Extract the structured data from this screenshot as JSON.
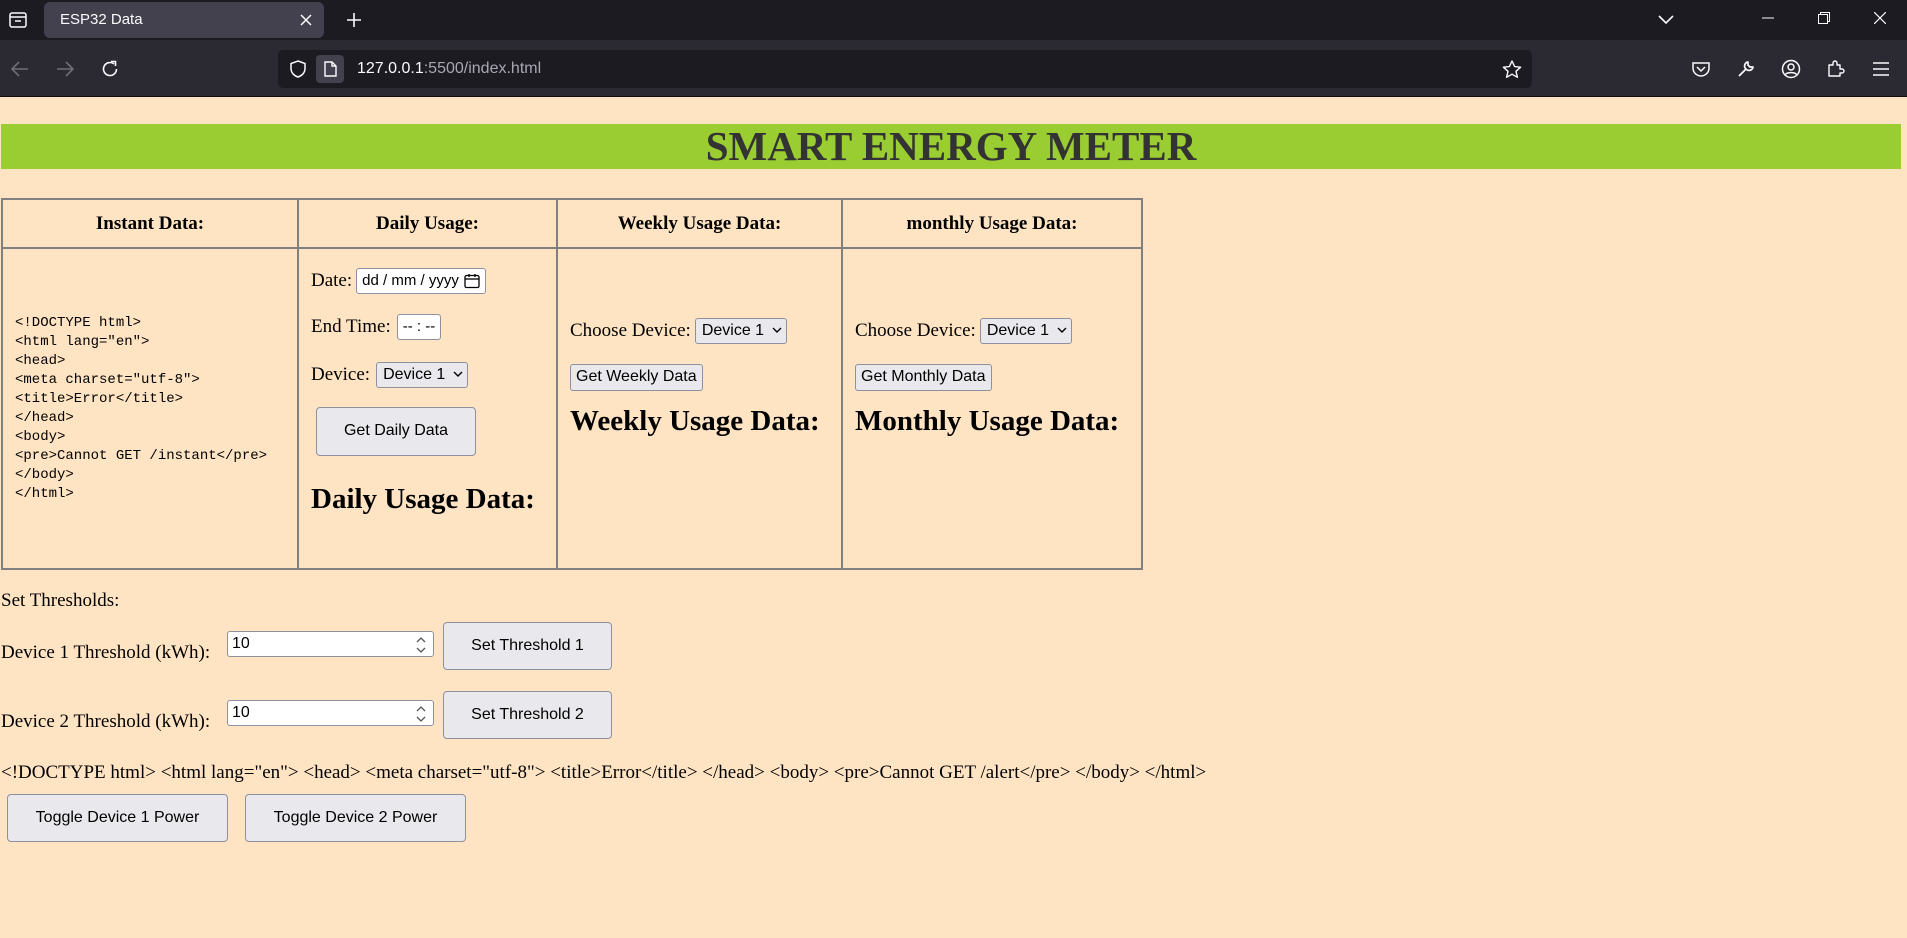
{
  "browser": {
    "tab_title": "ESP32 Data",
    "url_host": "127.0.0.1",
    "url_path": ":5500/index.html"
  },
  "page": {
    "title": "SMART ENERGY METER",
    "table": {
      "headers": [
        "Instant Data:",
        "Daily Usage:",
        "Weekly Usage Data:",
        "monthly Usage Data:"
      ],
      "instant": {
        "content": "<!DOCTYPE html>\n<html lang=\"en\">\n<head>\n<meta charset=\"utf-8\">\n<title>Error</title>\n</head>\n<body>\n<pre>Cannot GET /instant</pre>\n</body>\n</html>"
      },
      "daily": {
        "date_label": "Date:",
        "date_placeholder": "dd / mm / yyyy",
        "end_time_label": "End Time:",
        "end_time_placeholder": "-- : --",
        "device_label": "Device:",
        "device_value": "Device 1",
        "button": "Get Daily Data",
        "heading": "Daily Usage Data:"
      },
      "weekly": {
        "choose_label": "Choose Device:",
        "device_value": "Device 1",
        "button": "Get Weekly Data",
        "heading": "Weekly Usage Data:"
      },
      "monthly": {
        "choose_label": "Choose Device:",
        "device_value": "Device 1",
        "button": "Get Monthly Data",
        "heading": "Monthly Usage Data:"
      }
    },
    "thresholds": {
      "heading": "Set Thresholds:",
      "device1": {
        "label": "Device 1 Threshold (kWh):",
        "value": "10",
        "button": "Set Threshold 1"
      },
      "device2": {
        "label": "Device 2 Threshold (kWh):",
        "value": "10",
        "button": "Set Threshold 2"
      }
    },
    "alert_text": "<!DOCTYPE html> <html lang=\"en\"> <head> <meta charset=\"utf-8\"> <title>Error</title> </head> <body> <pre>Cannot GET /alert</pre> </body> </html>",
    "toggle": {
      "device1": "Toggle Device 1 Power",
      "device2": "Toggle Device 2 Power"
    }
  }
}
